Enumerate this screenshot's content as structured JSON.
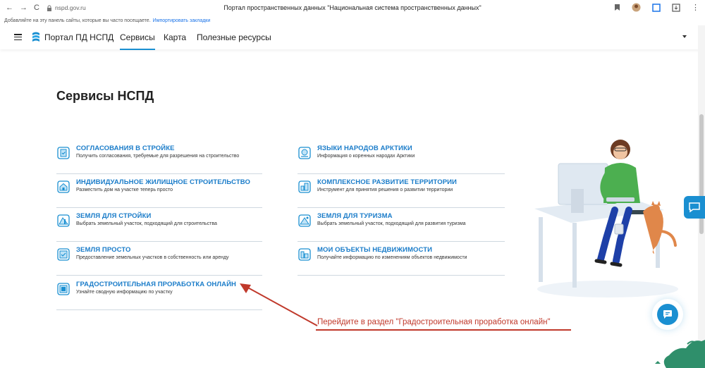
{
  "browser": {
    "back": "←",
    "forward": "→",
    "reload": "C",
    "url": "nspd.gov.ru",
    "window_title": "Портал пространственных данных \"Национальная система пространственных данных\"",
    "bookmarks_prompt": "Добавляйте на эту панель сайты, которые вы часто посещаете.",
    "bookmarks_link": "Импортировать закладки"
  },
  "header": {
    "brand": "Портал ПД НСПД",
    "nav": [
      {
        "label": "Сервисы"
      },
      {
        "label": "Карта"
      },
      {
        "label": "Полезные ресурсы"
      }
    ]
  },
  "page": {
    "title": "Сервисы НСПД"
  },
  "services_left": [
    {
      "title": "СОГЛАСОВАНИЯ В СТРОЙКЕ",
      "desc": "Получить согласования, требуемые для разрешения на строительство",
      "icon": "document-check-icon"
    },
    {
      "title": "ИНДИВИДУАЛЬНОЕ ЖИЛИЩНОЕ СТРОИТЕЛЬСТВО",
      "desc": "Разместить дом на участке теперь просто",
      "icon": "house-plot-icon"
    },
    {
      "title": "ЗЕМЛЯ ДЛЯ СТРОЙКИ",
      "desc": "Выбрать земельный участок, подходящий для строительства",
      "icon": "construction-land-icon"
    },
    {
      "title": "ЗЕМЛЯ ПРОСТО",
      "desc": "Предоставление земельных участков в собственность или аренду",
      "icon": "land-document-icon"
    },
    {
      "title": "ГРАДОСТРОИТЕЛЬНАЯ ПРОРАБОТКА ОНЛАЙН",
      "desc": "Узнайте сводную информацию по участку",
      "icon": "urban-planning-icon"
    }
  ],
  "services_right": [
    {
      "title": "ЯЗЫКИ НАРОДОВ АРКТИКИ",
      "desc": "Информация о коренных народах Арктики",
      "icon": "arctic-languages-icon"
    },
    {
      "title": "КОМПЛЕКСНОЕ РАЗВИТИЕ ТЕРРИТОРИИ",
      "desc": "Инструмент для принятия решения о развитии территории",
      "icon": "territory-development-icon"
    },
    {
      "title": "ЗЕМЛЯ ДЛЯ ТУРИЗМА",
      "desc": "Выбрать земельный участок, подходящий для развития туризма",
      "icon": "tourism-land-icon"
    },
    {
      "title": "МОИ ОБЪЕКТЫ НЕДВИЖИМОСТИ",
      "desc": "Получайте информацию по изменениям объектов недвижимости",
      "icon": "my-property-icon"
    }
  ],
  "annotation": {
    "text": "Перейдите в раздел \"Градостроительная проработка онлайн\""
  },
  "colors": {
    "accent": "#1a8fd1",
    "link": "#1a7cc9",
    "annotation": "#c0392b"
  }
}
